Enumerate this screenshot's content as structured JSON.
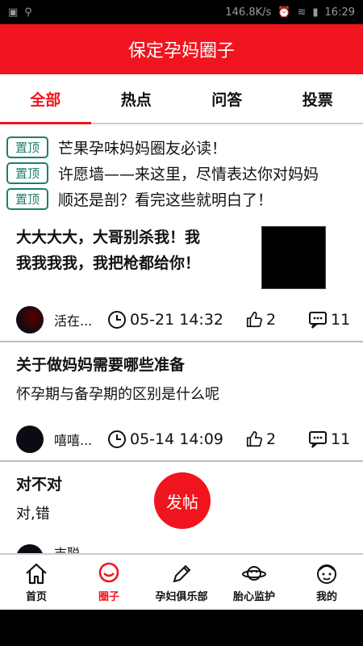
{
  "statusbar": {
    "speed": "146.8K/s",
    "time": "16:29"
  },
  "header": {
    "title": "保定孕妈圈子"
  },
  "tabs": [
    {
      "label": "全部"
    },
    {
      "label": "热点"
    },
    {
      "label": "问答"
    },
    {
      "label": "投票"
    }
  ],
  "pinned": [
    {
      "badge": "置顶",
      "title": "芒果孕味妈妈圈友必读！"
    },
    {
      "badge": "置顶",
      "title": "许愿墙——来这里，尽情表达你对妈妈"
    },
    {
      "badge": "置顶",
      "title": "顺还是剖？看完这些就明白了！"
    }
  ],
  "posts": [
    {
      "title_line1": "大大大大，大哥别杀我！我",
      "title_line2": "我我我我，我把枪都给你！",
      "author": "活在...",
      "time": "05-21 14:32",
      "likes": "2",
      "comments": "11"
    },
    {
      "title": "关于做妈妈需要哪些准备",
      "body": "怀孕期与备孕期的区别是什么呢",
      "author": "嘻嘻...",
      "time": "05-14 14:09",
      "likes": "2",
      "comments": "11"
    },
    {
      "title": "对不对",
      "body": "对,错",
      "author": "吉聪"
    }
  ],
  "fab": {
    "label": "发帖"
  },
  "bottomnav": [
    {
      "label": "首页",
      "icon": "home-icon"
    },
    {
      "label": "圈子",
      "icon": "circle-chat-icon"
    },
    {
      "label": "孕妇俱乐部",
      "icon": "pencil-icon"
    },
    {
      "label": "胎心监护",
      "icon": "planet-icon"
    },
    {
      "label": "我的",
      "icon": "user-face-icon"
    }
  ],
  "colors": {
    "brand": "#f0141e",
    "pin": "#1d7f6c"
  }
}
